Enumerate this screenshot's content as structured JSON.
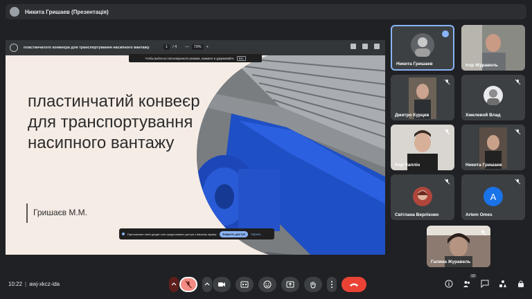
{
  "header": {
    "presenter_title": "Никита Гришаев (Презентація)"
  },
  "pdf_viewer": {
    "doc_title": "пластинчатого конвеєра для транспортування насипного вантажу",
    "page_current": "1",
    "page_total": "/ 4",
    "zoom": "79%",
    "zoom_minus": "—",
    "zoom_plus": "+"
  },
  "fullscreen_tip": {
    "text": "Чтобы выйти из полноэкранного режима, нажмите и удерживайте",
    "key": "Esc"
  },
  "slide": {
    "title": "пластинчатий конвеєр для транспортування насипного вантажу",
    "author": "Гришаєв М.М."
  },
  "share_banner": {
    "text": "Приложение meet.google.com предоставило доступ к вашему экрану.",
    "allow_label": "Закрыть доступ",
    "hide_label": "Скрыть"
  },
  "participants": [
    {
      "name": "Никита Гришаев",
      "state": "speaking"
    },
    {
      "name": "Ігор Журавель",
      "state": "video"
    },
    {
      "name": "Дмитро Курцев",
      "state": "muted"
    },
    {
      "name": "Хмелевой Влад",
      "state": "muted"
    },
    {
      "name": "Ігор Чаплін",
      "state": "muted"
    },
    {
      "name": "Никита Гришаев",
      "state": "muted"
    },
    {
      "name": "Світлана Верлієнко",
      "state": "muted"
    },
    {
      "name": "Artem Omes",
      "state": "muted",
      "initial": "A",
      "color": "#1a73e8"
    },
    {
      "name": "Галина Журавель",
      "state": "muted"
    }
  ],
  "footer": {
    "time": "10:22",
    "meeting_code": "awj-xkcz-ida",
    "participant_count": "10"
  },
  "colors": {
    "background": "#202124",
    "tile": "#3c4043",
    "accent": "#8ab4f8",
    "danger": "#ea4335"
  },
  "icons": [
    "menu-icon",
    "download-icon",
    "print-icon",
    "more-icon",
    "mic-off-icon",
    "camera-icon",
    "captions-icon",
    "emoji-icon",
    "present-icon",
    "raise-hand-icon",
    "hangup-icon",
    "info-icon",
    "people-icon",
    "chat-icon",
    "activities-icon",
    "lock-icon"
  ]
}
